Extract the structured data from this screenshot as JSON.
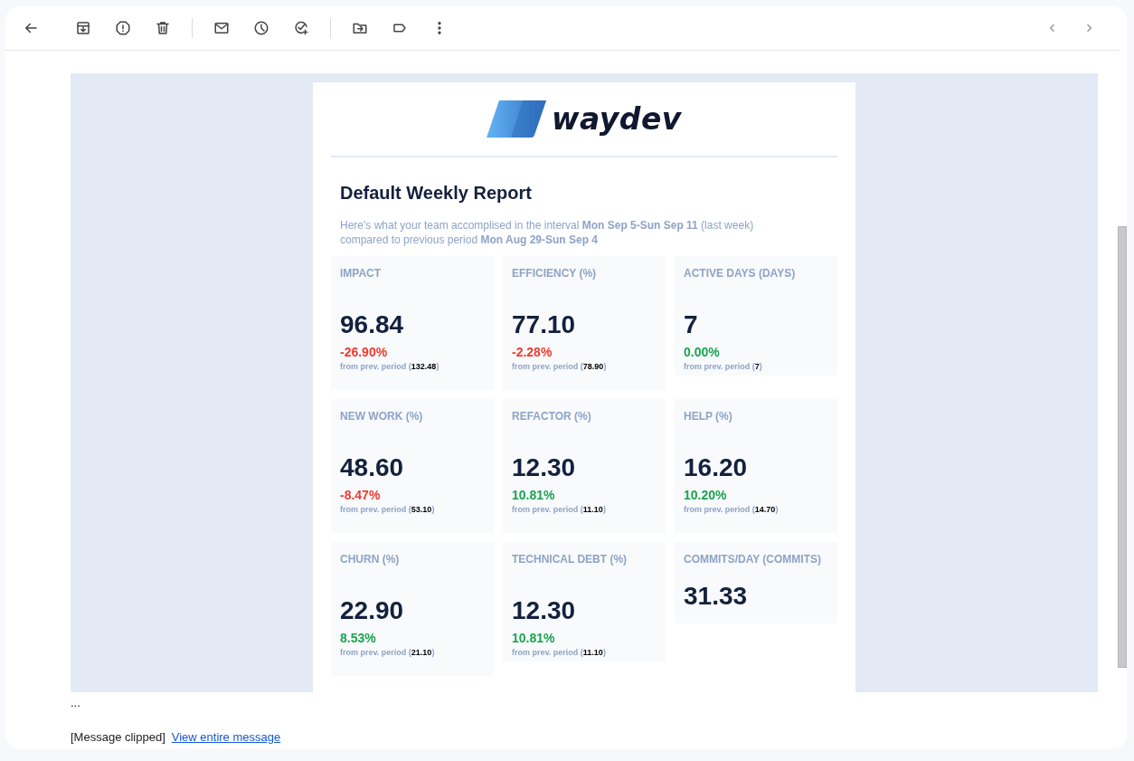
{
  "logo": {
    "wordmark": "waydev"
  },
  "report": {
    "title": "Default Weekly Report",
    "intro": "Here's what your team accomplised in the interval **Mon Sep 5-Sun Sep 11** (last week) compared to previous period **Mon Aug 29-Sun Sep 4**",
    "metrics": [
      {
        "label": "IMPACT",
        "value": "96.84",
        "change": "-26.90%",
        "color": "#ef3b2d",
        "note": "from prev. period (",
        "previous": "132.48",
        "note_end": ")"
      },
      {
        "label": "EFFICIENCY (%)",
        "value": "77.10",
        "change": "-2.28%",
        "color": "#ef3b2d",
        "note": "from prev. period (",
        "previous": "78.90",
        "note_end": ")"
      },
      {
        "label": "ACTIVE DAYS (DAYS)",
        "value": "7",
        "change": "0.00%",
        "color": "#1aa350",
        "note": "from prev. period (",
        "previous": "7",
        "note_end": ")"
      },
      {
        "label": "NEW WORK (%)",
        "value": "48.60",
        "change": "-8.47%",
        "color": "#ef3b2d",
        "note": "from prev. period (",
        "previous": "53.10",
        "note_end": ")"
      },
      {
        "label": "REFACTOR (%)",
        "value": "12.30",
        "change": "10.81%",
        "color": "#1aa350",
        "note": "from prev. period (",
        "previous": "11.10",
        "note_end": ")"
      },
      {
        "label": "HELP (%)",
        "value": "16.20",
        "change": "10.20%",
        "color": "#1aa350",
        "note": "from prev. period (",
        "previous": "14.70",
        "note_end": ")"
      },
      {
        "label": "CHURN (%)",
        "value": "22.90",
        "change": "8.53%",
        "color": "#1aa350",
        "note": "from prev. period (",
        "previous": "21.10",
        "note_end": ")"
      },
      {
        "label": "TECHNICAL DEBT (%)",
        "value": "12.30",
        "change": "10.81%",
        "color": "#1aa350",
        "note": "from prev. period (",
        "previous": "11.10",
        "note_end": ")"
      },
      {
        "label": "COMMITS/DAY (COMMITS)",
        "value": "31.33"
      }
    ]
  },
  "ellipsis": "...",
  "clipped": {
    "text": "[Message clipped]",
    "link": "View entire message"
  }
}
